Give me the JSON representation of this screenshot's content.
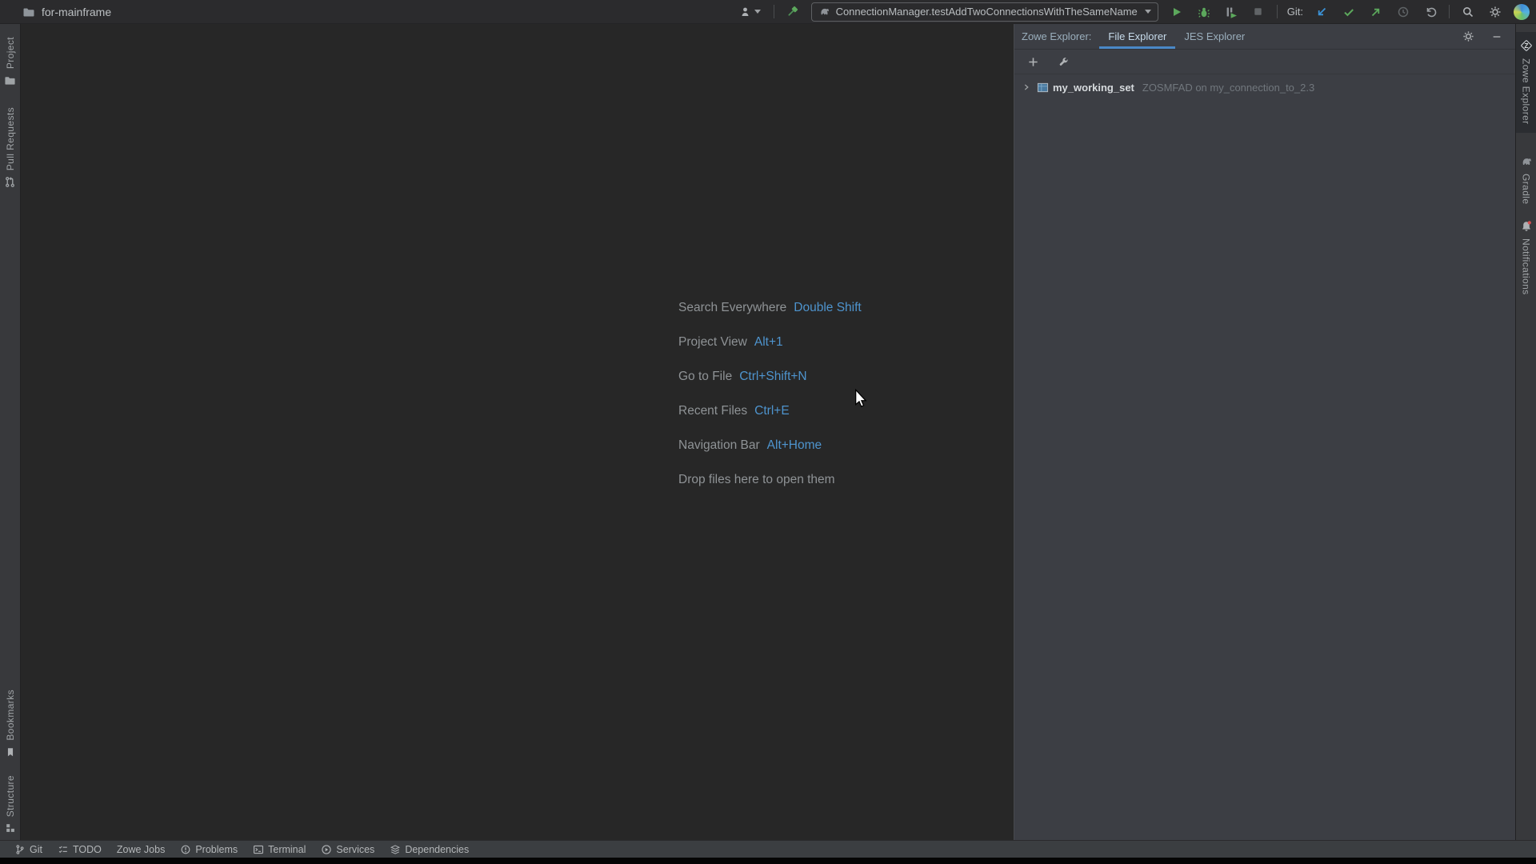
{
  "titlebar": {
    "project_name": "for-mainframe",
    "run_config_value": "ConnectionManager.testAddTwoConnectionsWithTheSameName",
    "git_label": "Git:"
  },
  "left_stripe": {
    "project_label": "Project",
    "pull_requests_label": "Pull Requests",
    "bookmarks_label": "Bookmarks",
    "structure_label": "Structure"
  },
  "right_stripe": {
    "zowe_label": "Zowe Explorer",
    "zowe_icon_letter": "Z",
    "gradle_label": "Gradle",
    "notifications_label": "Notifications"
  },
  "editor_hints": {
    "rows": [
      {
        "label": "Search Everywhere",
        "shortcut": "Double Shift"
      },
      {
        "label": "Project View",
        "shortcut": "Alt+1"
      },
      {
        "label": "Go to File",
        "shortcut": "Ctrl+Shift+N"
      },
      {
        "label": "Recent Files",
        "shortcut": "Ctrl+E"
      },
      {
        "label": "Navigation Bar",
        "shortcut": "Alt+Home"
      }
    ],
    "drop_hint": "Drop files here to open them"
  },
  "zowe_panel": {
    "title": "Zowe Explorer:",
    "tabs": [
      {
        "label": "File Explorer"
      },
      {
        "label": "JES Explorer"
      }
    ],
    "tree": [
      {
        "name": "my_working_set",
        "detail": "ZOSMFAD on my_connection_to_2.3"
      }
    ]
  },
  "status_bar": {
    "items": [
      {
        "label": "Git"
      },
      {
        "label": "TODO"
      },
      {
        "label": "Zowe Jobs"
      },
      {
        "label": "Problems"
      },
      {
        "label": "Terminal"
      },
      {
        "label": "Services"
      },
      {
        "label": "Dependencies"
      }
    ]
  },
  "colors": {
    "accent_blue": "#4e94ce",
    "tab_underline": "#4a88c7",
    "run_green": "#5ca85c",
    "git_update_blue": "#3b92d6",
    "notification_badge_red": "#d75050",
    "panel_bg": "#3c3e44",
    "editor_bg": "#272727",
    "titlebar_bg": "#2b2b2d"
  }
}
